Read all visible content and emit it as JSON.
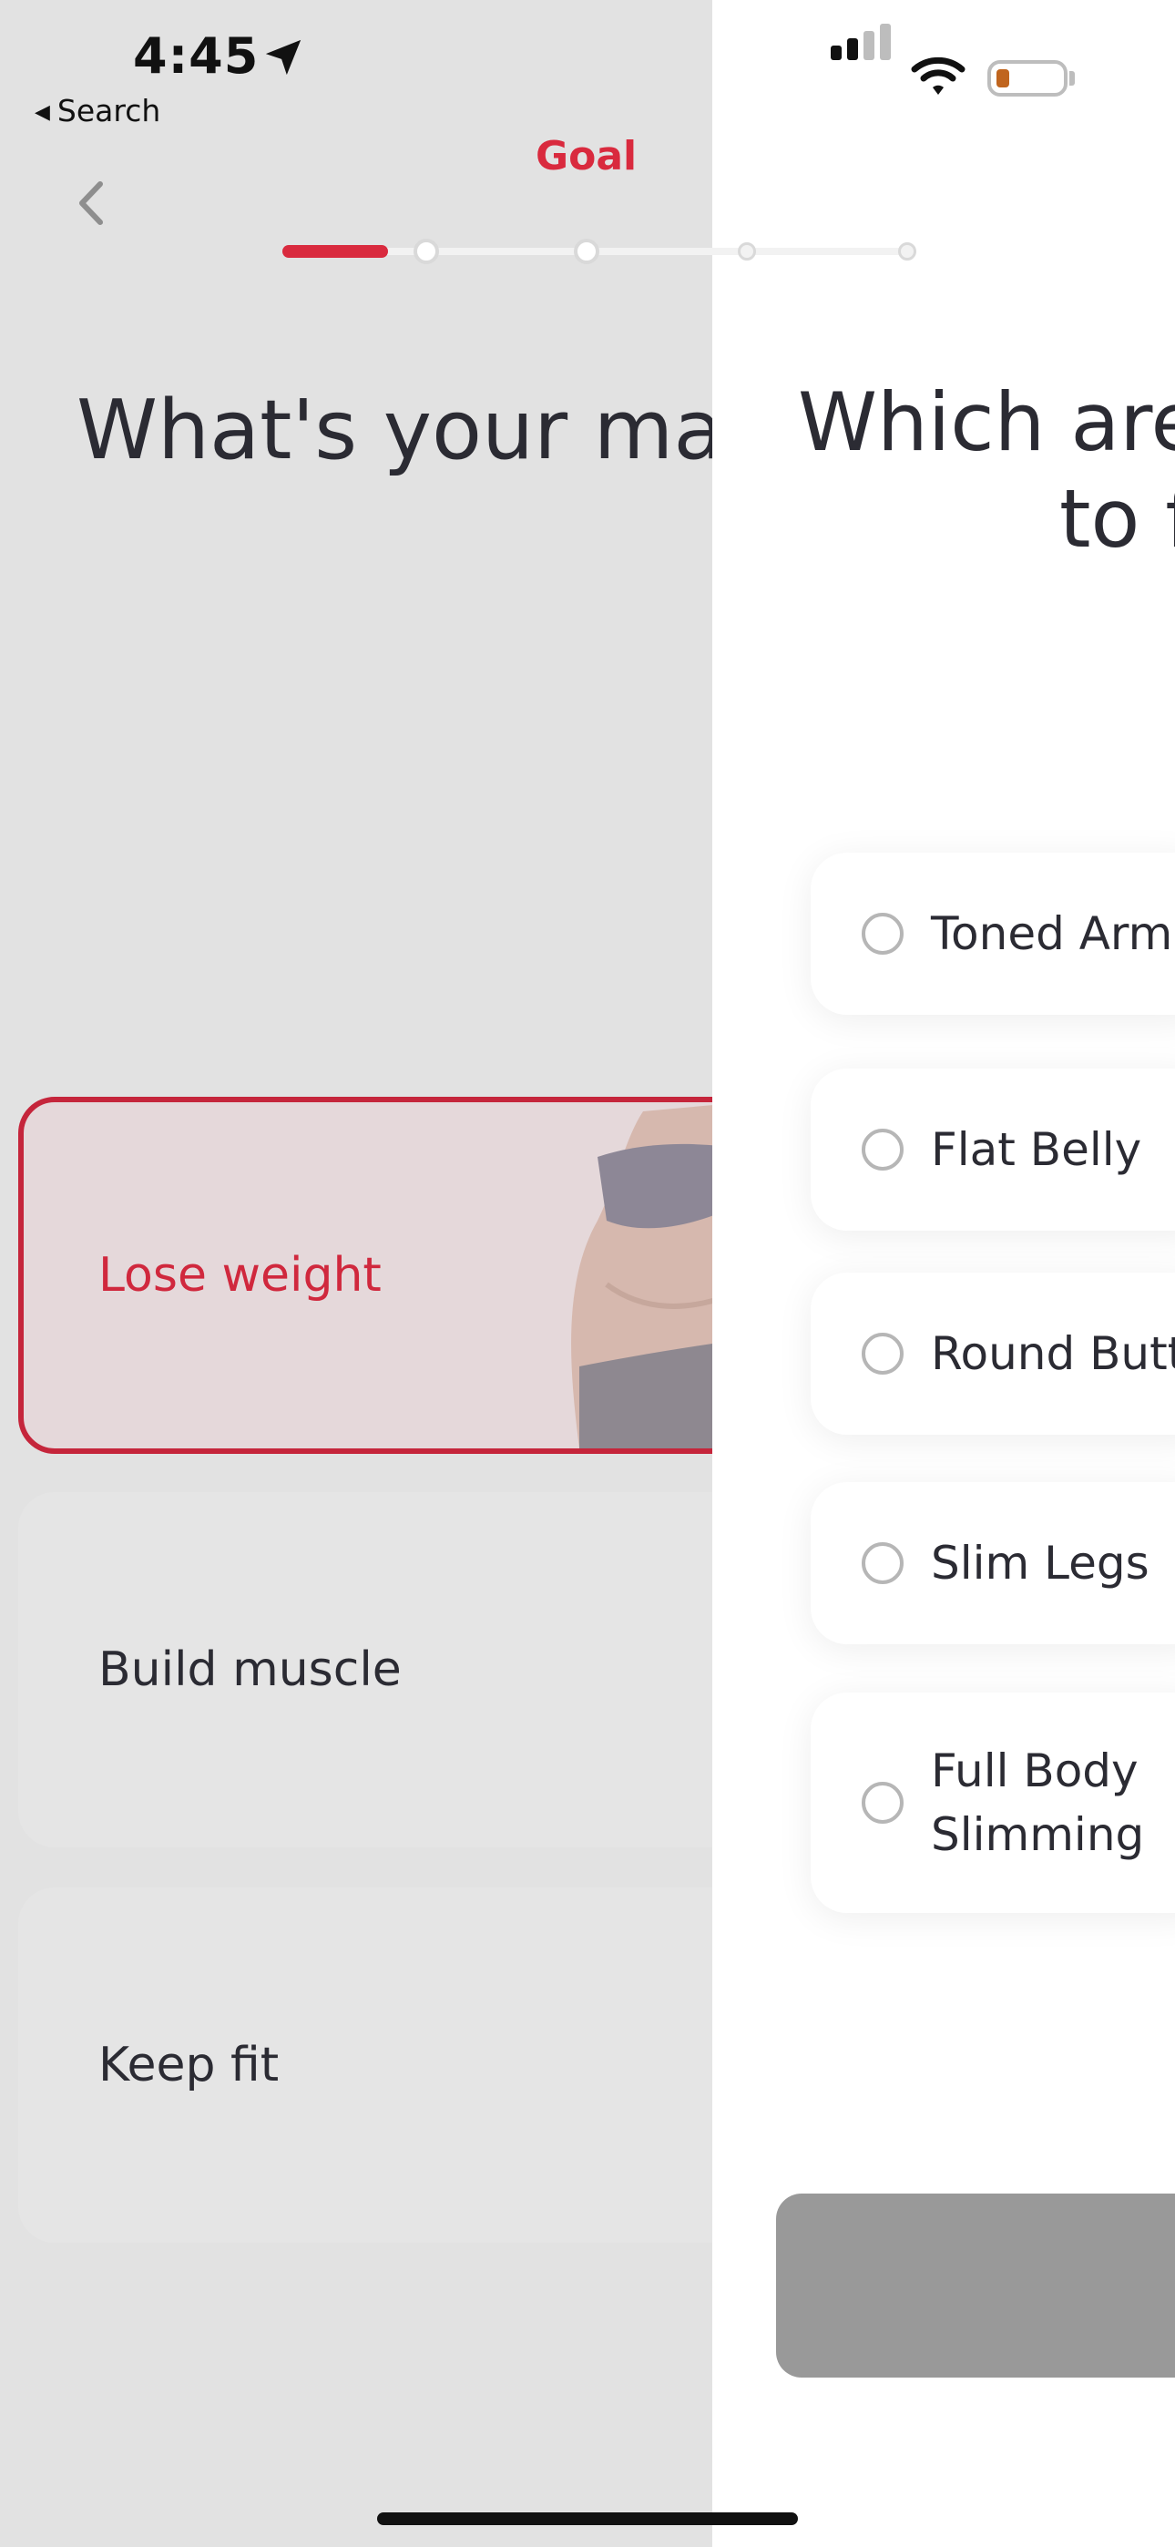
{
  "status_bar": {
    "time": "4:45",
    "back_label": "Search",
    "location_icon": "location-arrow-icon",
    "signal_icon": "cellular-signal-icon",
    "wifi_icon": "wifi-icon",
    "battery_icon": "battery-low-icon",
    "battery_level": 0.15,
    "battery_color": "#c0651e"
  },
  "header": {
    "step_title": "Goal",
    "back_icon": "chevron-left-icon",
    "accent_color": "#d92a3e",
    "progress_fraction": 0.17
  },
  "left_screen": {
    "question": "What's your mai",
    "options": [
      {
        "label": "Lose weight",
        "selected": true
      },
      {
        "label": "Build muscle",
        "selected": false
      },
      {
        "label": "Keep fit",
        "selected": false
      }
    ]
  },
  "right_screen": {
    "question_line1": "Which are",
    "question_line2": "to f",
    "options": [
      {
        "label": "Toned Arm"
      },
      {
        "label": "Flat Belly"
      },
      {
        "label": "Round Butt"
      },
      {
        "label": "Slim Legs"
      },
      {
        "label": "Full Body Slimming"
      }
    ],
    "next_button_color": "#999999"
  }
}
